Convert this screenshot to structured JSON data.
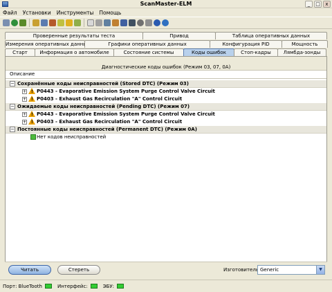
{
  "window": {
    "title": "ScanMaster-ELM",
    "minimize": "_",
    "maximize": "□",
    "close": "x"
  },
  "menu": [
    "Файл",
    "Установки",
    "Инструменты",
    "Помощь"
  ],
  "tabs_row1": [
    "Проверенные результаты теста",
    "Привод",
    "Таблица оперативных данных"
  ],
  "tabs_row2": [
    "Измерения оперативных данных",
    "Графики оперативных данных",
    "Конфигурация PID",
    "Мощность"
  ],
  "tabs_row3": [
    "Старт",
    "Информация о автомобиле",
    "Состояние системы",
    "Коды ошибок",
    "Стоп-кадры",
    "Лямбда-зонды"
  ],
  "active_tab": "Коды ошибок",
  "panel": {
    "title": "Диагностические коды ошибок (Режим 03, 07, 0A)",
    "column_header": "Описание",
    "groups": [
      {
        "label": "Сохранённые коды неисправностей (Stored DTC) (Режим 03)",
        "items": [
          {
            "code": "P0443 - Evaporative Emission System Purge Control Valve Circuit"
          },
          {
            "code": "P0403 - Exhaust Gas Recirculation \"A\" Control Circuit"
          }
        ]
      },
      {
        "label": "Ожидаемые коды неисправностей (Pending DTC) (Режим 07)",
        "items": [
          {
            "code": "P0443 - Evaporative Emission System Purge Control Valve Circuit"
          },
          {
            "code": "P0403 - Exhaust Gas Recirculation \"A\" Control Circuit"
          }
        ]
      },
      {
        "label": "Постоянные коды неисправностей (Permanent DTC) (Режим 0A)",
        "ok_message": "Нет кодов неисправностей"
      }
    ]
  },
  "footer": {
    "read_label": "Читать",
    "clear_label": "Стереть",
    "manufacturer_label": "Изготовитель",
    "manufacturer_value": "Generic"
  },
  "status": {
    "port": "Порт: BlueTooth",
    "interface": "Интерфейс:",
    "ecu": "ЭБУ:"
  },
  "colors": {
    "accent": "#b9d1ec",
    "warning": "#e8a000",
    "ok": "#4dbb3c",
    "status_led": "#33cc33"
  },
  "toolbar_icons": [
    "pen-icon",
    "globe-icon",
    "connect-icon",
    "graph-icon",
    "table-icon",
    "gauge-icon",
    "sensor-icon",
    "dollar-icon",
    "arrow-icon",
    "document-icon",
    "plug-icon",
    "monitor-icon",
    "cup-icon",
    "chart-icon",
    "display-icon",
    "disc-icon",
    "settings-icon",
    "info-icon",
    "globe2-icon"
  ]
}
